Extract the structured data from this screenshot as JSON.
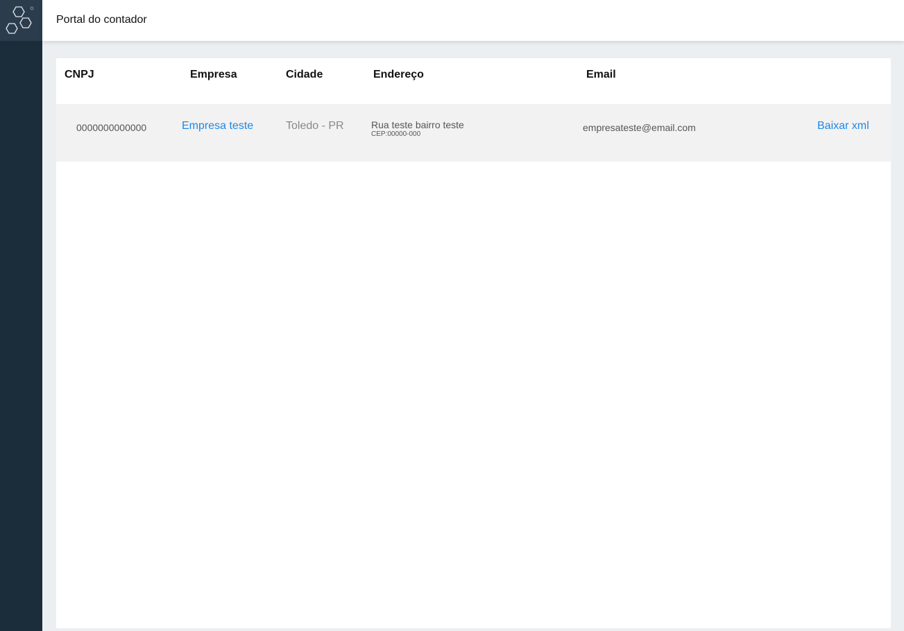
{
  "header": {
    "title": "Portal do contador"
  },
  "table": {
    "columns": {
      "cnpj": "CNPJ",
      "empresa": "Empresa",
      "cidade": "Cidade",
      "endereco": "Endereço",
      "email": "Email"
    },
    "rows": [
      {
        "cnpj": "0000000000000",
        "empresa": "Empresa teste",
        "cidade": "Toledo - PR",
        "endereco": "Rua teste bairro teste",
        "cep": "CEP:00000-000",
        "email": "empresateste@email.com",
        "action": "Baixar xml"
      }
    ]
  },
  "colors": {
    "sidebar": "#1b2c3b",
    "logo_bg": "#2b3d4d",
    "link": "#1e88e5",
    "row_bg": "#f2f2f2",
    "page_bg": "#eceff2"
  }
}
